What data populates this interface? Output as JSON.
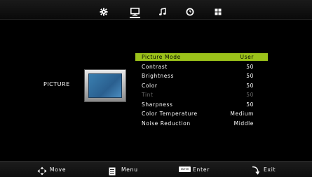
{
  "top_tabs": [
    {
      "icon": "gear-icon",
      "active": false
    },
    {
      "icon": "monitor-icon",
      "active": true
    },
    {
      "icon": "music-note-icon",
      "active": false
    },
    {
      "icon": "clock-icon",
      "active": false
    },
    {
      "icon": "grid-icon",
      "active": false
    }
  ],
  "section": {
    "title": "PICTURE"
  },
  "menu": {
    "items": [
      {
        "label": "Picture Mode",
        "value": "User",
        "selected": true,
        "disabled": false
      },
      {
        "label": "Contrast",
        "value": "50",
        "selected": false,
        "disabled": false
      },
      {
        "label": "Brightness",
        "value": "50",
        "selected": false,
        "disabled": false
      },
      {
        "label": "Color",
        "value": "50",
        "selected": false,
        "disabled": false
      },
      {
        "label": "Tint",
        "value": "50",
        "selected": false,
        "disabled": true
      },
      {
        "label": "Sharpness",
        "value": "50",
        "selected": false,
        "disabled": false
      },
      {
        "label": "Color Temperature",
        "value": "Medium",
        "selected": false,
        "disabled": false
      },
      {
        "label": "Noise Reduction",
        "value": "Middle",
        "selected": false,
        "disabled": false
      }
    ]
  },
  "bottom_hints": {
    "move": "Move",
    "menu": "Menu",
    "enter_key": "ENTER",
    "enter": "Enter",
    "exit": "Exit"
  },
  "colors": {
    "highlight": "#9bc21a",
    "disabled_text": "#6a6a6a"
  }
}
